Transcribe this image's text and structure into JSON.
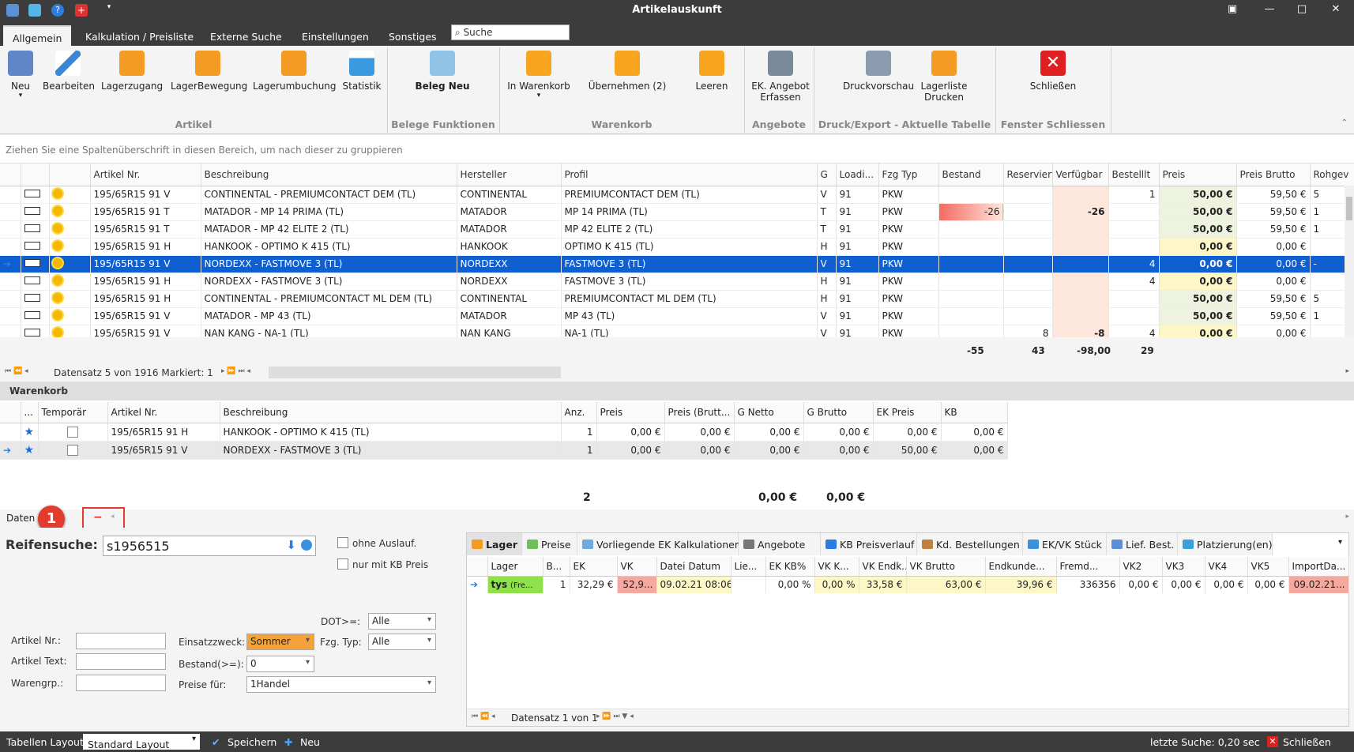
{
  "window": {
    "title": "Artikelauskunft"
  },
  "tabs": [
    "Allgemein",
    "Kalkulation / Preisliste",
    "Externe Suche",
    "Einstellungen",
    "Sonstiges"
  ],
  "search": {
    "placeholder": "Suche"
  },
  "ribbon": {
    "buttons": [
      {
        "label": "Neu",
        "sub": "▾",
        "icon": "new-article-icon"
      },
      {
        "label": "Bearbeiten",
        "icon": "pencil-icon"
      },
      {
        "label": "Lagerzugang",
        "icon": "stock-add-icon"
      },
      {
        "label": "LagerBewegung",
        "icon": "stock-move-icon"
      },
      {
        "label": "Lagerumbuchung",
        "icon": "stock-rebook-icon"
      },
      {
        "label": "Statistik",
        "icon": "chart-icon"
      },
      {
        "label": "Beleg Neu",
        "icon": "new-document-icon"
      },
      {
        "label": "In Warenkorb",
        "sub": "▾",
        "icon": "cart-add-icon"
      },
      {
        "label": "Übernehmen (2)",
        "icon": "cart-check-icon"
      },
      {
        "label": "Leeren",
        "icon": "cart-empty-icon"
      },
      {
        "label": "EK. Angebot",
        "label2": "Erfassen",
        "icon": "calculator-icon"
      },
      {
        "label": "Druckvorschau",
        "icon": "printer-icon"
      },
      {
        "label": "Lagerliste",
        "label2": "Drucken",
        "icon": "print-list-icon"
      },
      {
        "label": "Schließen",
        "icon": "close-icon"
      }
    ],
    "groups": [
      "Artikel",
      "Belege Funktionen",
      "Warenkorb",
      "Angebote",
      "Druck/Export - Aktuelle Tabelle",
      "Fenster Schliessen"
    ]
  },
  "grouphint": "Ziehen Sie eine Spaltenüberschrift in diesen Bereich, um nach dieser zu gruppieren",
  "maingrid": {
    "columns": [
      "Artikel Nr.",
      "Beschreibung",
      "Hersteller",
      "Profil",
      "G",
      "Loadi...",
      "Fzg Typ",
      "Bestand",
      "Reserviert",
      "Verfügbar",
      "Bestelllt",
      "Preis",
      "Preis Brutto",
      "Rohgev"
    ],
    "rows": [
      [
        "195/65R15 91 V",
        "CONTINENTAL - PREMIUMCONTACT DEM (TL)",
        "CONTINENTAL",
        "PREMIUMCONTACT DEM (TL)",
        "V",
        "91",
        "PKW",
        "",
        "",
        "",
        "1",
        "50,00 €",
        "59,50 €",
        "5"
      ],
      [
        "195/65R15 91 T",
        "MATADOR - MP 14 PRIMA (TL)",
        "MATADOR",
        "MP 14 PRIMA (TL)",
        "T",
        "91",
        "PKW",
        "-26",
        "",
        "-26",
        "",
        "50,00 €",
        "59,50 €",
        "1"
      ],
      [
        "195/65R15 91 T",
        "MATADOR - MP 42 ELITE 2 (TL)",
        "MATADOR",
        "MP 42 ELITE 2 (TL)",
        "T",
        "91",
        "PKW",
        "",
        "",
        "",
        "",
        "50,00 €",
        "59,50 €",
        "1"
      ],
      [
        "195/65R15 91 H",
        "HANKOOK - OPTIMO K 415 (TL)",
        "HANKOOK",
        "OPTIMO K 415 (TL)",
        "H",
        "91",
        "PKW",
        "",
        "",
        "",
        "",
        "0,00 €",
        "0,00 €",
        ""
      ],
      [
        "195/65R15 91 V",
        "NORDEXX - FASTMOVE 3 (TL)",
        "NORDEXX",
        "FASTMOVE 3 (TL)",
        "V",
        "91",
        "PKW",
        "",
        "",
        "",
        "4",
        "0,00 €",
        "0,00 €",
        "-"
      ],
      [
        "195/65R15 91 H",
        "NORDEXX - FASTMOVE 3 (TL)",
        "NORDEXX",
        "FASTMOVE 3 (TL)",
        "H",
        "91",
        "PKW",
        "",
        "",
        "",
        "4",
        "0,00 €",
        "0,00 €",
        ""
      ],
      [
        "195/65R15 91 H",
        "CONTINENTAL - PREMIUMCONTACT ML DEM (TL)",
        "CONTINENTAL",
        "PREMIUMCONTACT ML DEM (TL)",
        "H",
        "91",
        "PKW",
        "",
        "",
        "",
        "",
        "50,00 €",
        "59,50 €",
        "5"
      ],
      [
        "195/65R15 91 V",
        "MATADOR - MP 43 (TL)",
        "MATADOR",
        "MP 43 (TL)",
        "V",
        "91",
        "PKW",
        "",
        "",
        "",
        "",
        "50,00 €",
        "59,50 €",
        "1"
      ],
      [
        "195/65R15 91 V",
        "NAN KANG - NA-1 (TL)",
        "NAN KANG",
        "NA-1 (TL)",
        "V",
        "91",
        "PKW",
        "",
        "8",
        "-8",
        "4",
        "0,00 €",
        "0,00 €",
        ""
      ]
    ],
    "selected_row": 4,
    "sums": {
      "bestand": "-55",
      "reserviert": "43",
      "verfuegbar": "-98,00",
      "bestellt": "29"
    },
    "nav": "Datensatz 5 von 1916 Markiert: 1"
  },
  "warenkorb": {
    "title": "Warenkorb",
    "columns": [
      "...",
      "Temporär",
      "Artikel Nr.",
      "Beschreibung",
      "Anz.",
      "Preis",
      "Preis (Brutt...",
      "G Netto",
      "G Brutto",
      "EK Preis",
      "KB"
    ],
    "rows": [
      [
        "195/65R15 91 H",
        "HANKOOK - OPTIMO K 415 (TL)",
        "1",
        "0,00 €",
        "0,00 €",
        "0,00 €",
        "0,00 €",
        "0,00 €",
        "0,00 €"
      ],
      [
        "195/65R15 91 V",
        "NORDEXX - FASTMOVE 3 (TL)",
        "1",
        "0,00 €",
        "0,00 €",
        "0,00 €",
        "0,00 €",
        "50,00 €",
        "0,00 €"
      ]
    ],
    "sum_anz": "2",
    "sum_gnetto": "0,00 €",
    "sum_gbrutto": "0,00 €",
    "nav": "Daten"
  },
  "annotation": {
    "badge": "1"
  },
  "reifensuche": {
    "label": "Reifensuche:",
    "value": "s1956515",
    "ohne_auslauf": "ohne Auslauf.",
    "nur_kb": "nur mit KB Preis",
    "dot_label": "DOT>=:",
    "dot_value": "Alle",
    "artikelnr_label": "Artikel Nr.:",
    "artikeltext_label": "Artikel Text:",
    "warengrp_label": "Warengrp.:",
    "einsatz_label": "Einsatzzweck:",
    "einsatz_value": "Sommer",
    "fzg_label": "Fzg. Typ:",
    "fzg_value": "Alle",
    "bestand_label": "Bestand(>=):",
    "bestand_value": "0",
    "preise_label": "Preise für:",
    "preise_value": "1Handel"
  },
  "detail": {
    "tabs": [
      "Lager",
      "Preise",
      "Vorliegende EK Kalkulationen",
      "Angebote",
      "KB Preisverlauf",
      "Kd. Bestellungen",
      "EK/VK Stück",
      "Lief. Best.",
      "Platzierung(en)"
    ],
    "columns": [
      "Lager",
      "B...",
      "EK",
      "VK",
      "Datei Datum",
      "Lie...",
      "EK KB%",
      "VK K...",
      "VK Endk...",
      "VK Brutto",
      "Endkunde...",
      "Fremd...",
      "VK2",
      "VK3",
      "VK4",
      "VK5",
      "ImportDa..."
    ],
    "row": [
      "tys",
      "(Fre...",
      "1",
      "32,29 €",
      "52,9...",
      "09.02.21 08:06",
      "",
      "0,00 %",
      "0,00 %",
      "33,58 €",
      "63,00 €",
      "39,96 €",
      "336356",
      "0,00 €",
      "0,00 €",
      "0,00 €",
      "0,00 €",
      "09.02.21..."
    ],
    "nav": "Datensatz 1 von 1"
  },
  "status": {
    "layout_label": "Tabellen Layout:",
    "layout_value": "Standard Layout",
    "save": "Speichern",
    "new": "Neu",
    "last_search": "letzte Suche: 0,20 sec",
    "close": "Schließen"
  },
  "colors": {
    "selection": "#0f5fd0",
    "dark_bar": "#3c3c3c",
    "accent_red": "#e33b2e",
    "sommer": "#f4a23a"
  }
}
